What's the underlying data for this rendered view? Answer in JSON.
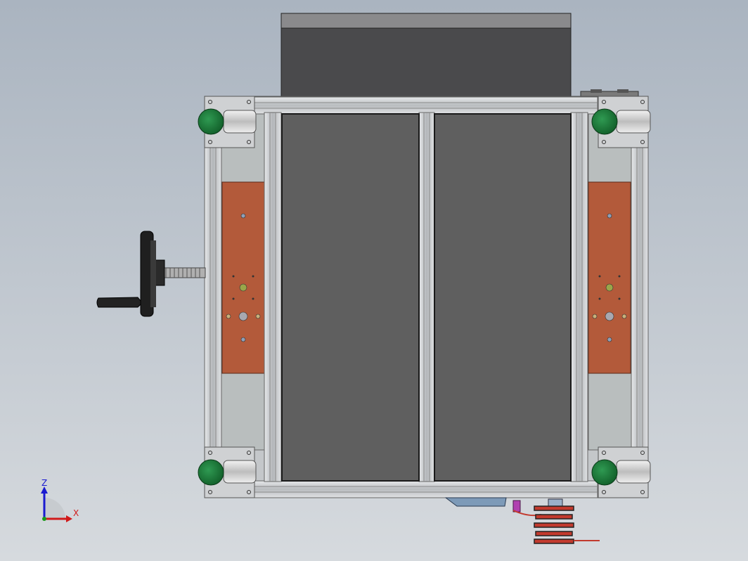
{
  "viewport": {
    "background_top": "#aab4c0",
    "background_bottom": "#d6dade"
  },
  "triad": {
    "z_label": "Z",
    "x_label": "X",
    "z_color": "#1a1ad0",
    "x_color": "#d01a1a"
  },
  "colors": {
    "frame": "#c8cacc",
    "frame_dark": "#8e9092",
    "panel": "#5f5f5f",
    "panel_dark": "#1f1f1f",
    "top_block": "#4a4a4c",
    "copper": "#b35a3a",
    "caster_wheel": "#1e7a3a",
    "handwheel": "#1f1f1f",
    "spring_red": "#c23a2e",
    "bracket_blue": "#7d9ab8",
    "magenta": "#b040b0"
  }
}
